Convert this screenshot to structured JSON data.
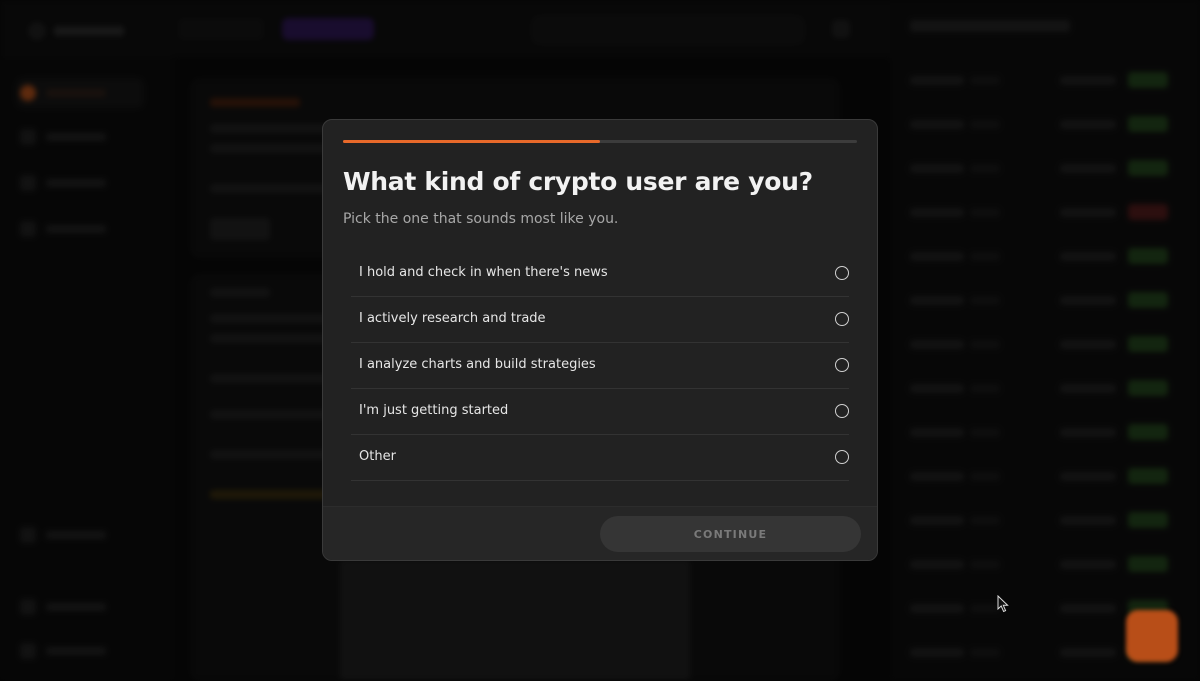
{
  "survey": {
    "progress_fraction": 0.5,
    "title": "What kind of crypto user are you?",
    "subtitle": "Pick the one that sounds most like you.",
    "options": [
      {
        "label": "I hold and check in when there's news",
        "selected": false
      },
      {
        "label": "I actively research and trade",
        "selected": false
      },
      {
        "label": "I analyze charts and build strategies",
        "selected": false
      },
      {
        "label": "I'm just getting started",
        "selected": false
      },
      {
        "label": "Other",
        "selected": false
      }
    ],
    "continue_label": "CONTINUE",
    "continue_enabled": false
  },
  "colors": {
    "accent": "#e8692a",
    "modal_bg": "#222222",
    "positive": "#3f7a33",
    "negative": "#8a2a2a"
  }
}
